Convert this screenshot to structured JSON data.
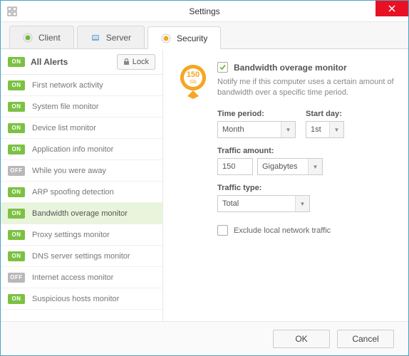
{
  "window": {
    "title": "Settings"
  },
  "tabs": [
    {
      "label": "Client",
      "icon_color": "#6fba3a"
    },
    {
      "label": "Server",
      "icon_color": "#7aa8d8"
    },
    {
      "label": "Security",
      "icon_color": "#f5a623"
    }
  ],
  "sidebar": {
    "header_label": "All Alerts",
    "header_toggle": "ON",
    "lock_label": "Lock",
    "items": [
      {
        "label": "First network activity",
        "state": "ON"
      },
      {
        "label": "System file monitor",
        "state": "ON"
      },
      {
        "label": "Device list monitor",
        "state": "ON"
      },
      {
        "label": "Application info monitor",
        "state": "ON"
      },
      {
        "label": "While you were away",
        "state": "OFF"
      },
      {
        "label": "ARP spoofing detection",
        "state": "ON"
      },
      {
        "label": "Bandwidth overage monitor",
        "state": "ON",
        "selected": true
      },
      {
        "label": "Proxy settings monitor",
        "state": "ON"
      },
      {
        "label": "DNS server settings monitor",
        "state": "ON"
      },
      {
        "label": "Internet access monitor",
        "state": "OFF"
      },
      {
        "label": "Suspicious hosts monitor",
        "state": "ON"
      }
    ]
  },
  "detail": {
    "badge_text": "150",
    "badge_unit": "Gb",
    "enable_checked": true,
    "enable_label": "Bandwidth overage monitor",
    "description": "Notify me if this computer uses a certain amount of bandwidth over a specific time period.",
    "time_period_label": "Time period:",
    "time_period_value": "Month",
    "start_day_label": "Start day:",
    "start_day_value": "1st",
    "traffic_amount_label": "Traffic amount:",
    "traffic_amount_value": "150",
    "traffic_amount_unit": "Gigabytes",
    "traffic_type_label": "Traffic type:",
    "traffic_type_value": "Total",
    "exclude_checked": false,
    "exclude_label": "Exclude local network traffic"
  },
  "footer": {
    "ok": "OK",
    "cancel": "Cancel"
  },
  "colors": {
    "accent_orange": "#f5a623",
    "toggle_on": "#7cc142",
    "toggle_off": "#b8b8b8"
  }
}
